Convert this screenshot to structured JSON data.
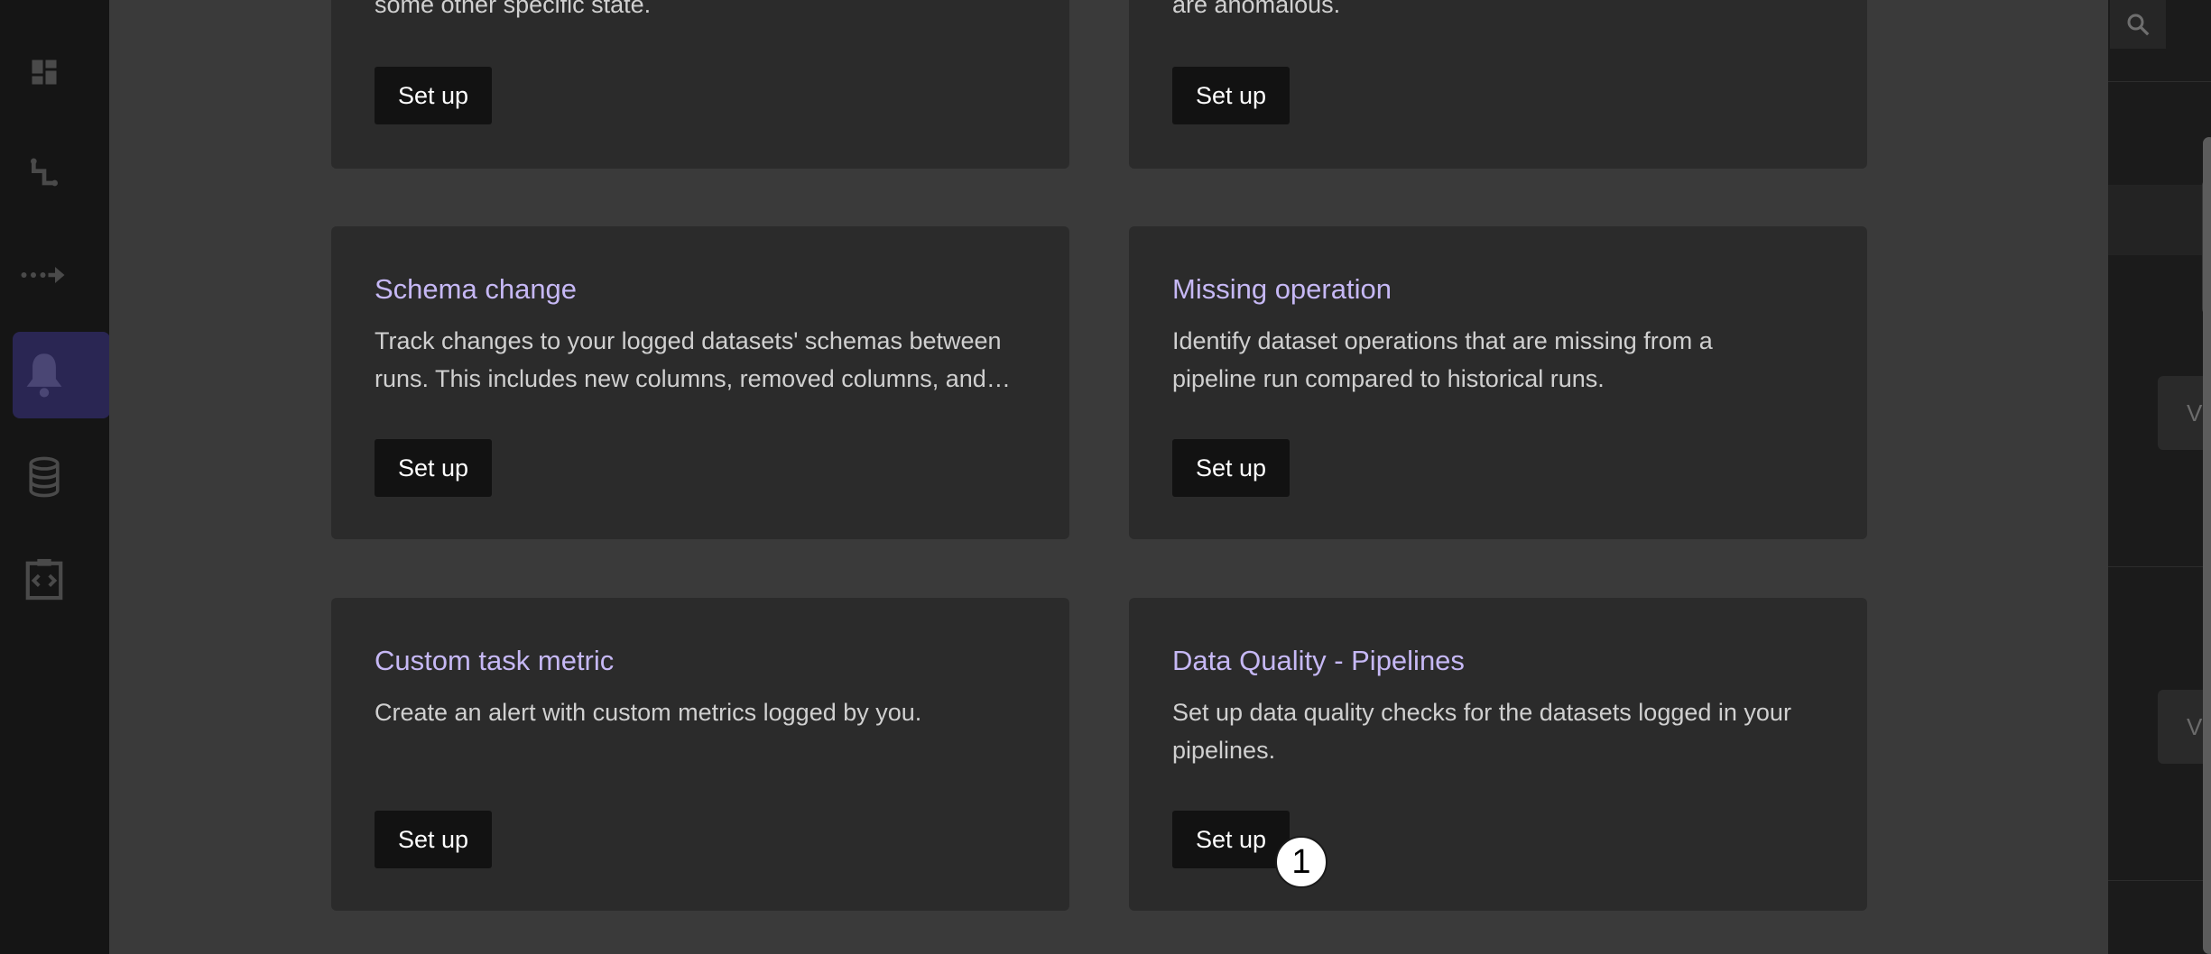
{
  "background_page": {
    "view_button_label": "V"
  },
  "sidebar": {
    "items": [
      {
        "icon": "dashboard-icon"
      },
      {
        "icon": "pipeline-icon"
      },
      {
        "icon": "lineage-icon"
      },
      {
        "icon": "bell-icon",
        "active": true
      },
      {
        "icon": "database-icon"
      },
      {
        "icon": "code-clipboard-icon"
      }
    ]
  },
  "modal": {
    "cards": [
      {
        "title": "",
        "description_lines": [
          "some other specific state."
        ],
        "button_label": "Set up"
      },
      {
        "title": "",
        "description_lines": [
          "are anomalous."
        ],
        "button_label": "Set up"
      },
      {
        "title": "Schema change",
        "description_lines": [
          "Track changes to your logged datasets' schemas between",
          "runs. This includes new columns, removed columns, and…"
        ],
        "button_label": "Set up"
      },
      {
        "title": "Missing operation",
        "description_lines": [
          "Identify dataset operations that are missing from a",
          "pipeline run compared to historical runs."
        ],
        "button_label": "Set up"
      },
      {
        "title": "Custom task metric",
        "description_lines": [
          "Create an alert with custom metrics logged by you."
        ],
        "button_label": "Set up"
      },
      {
        "title": "Data Quality - Pipelines",
        "description_lines": [
          "Set up data quality checks for the datasets logged in your",
          "pipelines."
        ],
        "button_label": "Set up"
      }
    ]
  },
  "annotation": {
    "marker_label": "1"
  },
  "colors": {
    "accent_title": "#c6b8f5",
    "active_nav": "#2a2653",
    "card_bg": "#2b2b2b",
    "modal_bg": "#3a3a3a",
    "button_bg": "#121212"
  }
}
